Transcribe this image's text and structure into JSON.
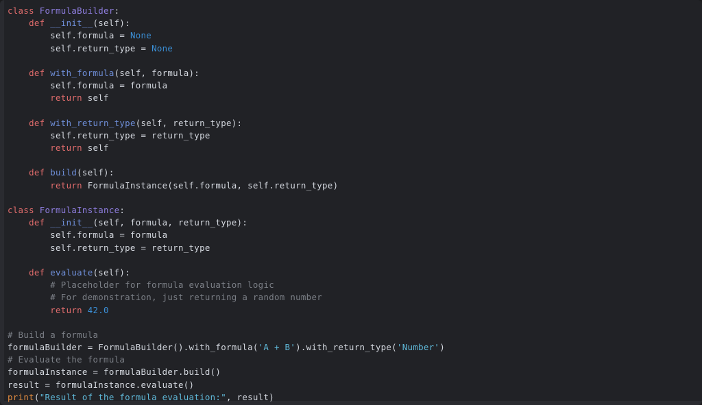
{
  "editor": {
    "language": "python",
    "background": "#212226",
    "panel_edge": "#2a2b30",
    "default_text": "#d3d7de"
  },
  "palette": {
    "keyword": "#e06c6c",
    "class_name": "#8f7ee0",
    "function_name": "#6f8fd9",
    "builtin": "#e08b40",
    "number": "#3b8fd6",
    "constant": "#3b8fd6",
    "string": "#5fb8d8",
    "comment": "#7b7f86",
    "plain": "#d3d7de"
  },
  "code": {
    "plain_text": "class FormulaBuilder:\n    def __init__(self):\n        self.formula = None\n        self.return_type = None\n\n    def with_formula(self, formula):\n        self.formula = formula\n        return self\n\n    def with_return_type(self, return_type):\n        self.return_type = return_type\n        return self\n\n    def build(self):\n        return FormulaInstance(self.formula, self.return_type)\n\nclass FormulaInstance:\n    def __init__(self, formula, return_type):\n        self.formula = formula\n        self.return_type = return_type\n\n    def evaluate(self):\n        # Placeholder for formula evaluation logic\n        # For demonstration, just returning a random number\n        return 42.0\n\n# Build a formula\nformulaBuilder = FormulaBuilder().with_formula('A + B').with_return_type('Number')\n# Evaluate the formula\nformulaInstance = formulaBuilder.build()\nresult = formulaInstance.evaluate()\nprint(\"Result of the formula evaluation:\", result)",
    "lines": [
      {
        "n": 1,
        "tokens": [
          {
            "t": "class",
            "c": "class"
          },
          {
            "t": " ",
            "c": "plain"
          },
          {
            "t": "FormulaBuilder",
            "c": "classname"
          },
          {
            "t": ":",
            "c": "punct"
          }
        ]
      },
      {
        "n": 2,
        "tokens": [
          {
            "t": "    ",
            "c": "plain"
          },
          {
            "t": "def",
            "c": "def"
          },
          {
            "t": " ",
            "c": "plain"
          },
          {
            "t": "__init__",
            "c": "funcname"
          },
          {
            "t": "(self):",
            "c": "punct"
          }
        ]
      },
      {
        "n": 3,
        "tokens": [
          {
            "t": "        self.formula = ",
            "c": "plain"
          },
          {
            "t": "None",
            "c": "const"
          }
        ]
      },
      {
        "n": 4,
        "tokens": [
          {
            "t": "        self.return_type = ",
            "c": "plain"
          },
          {
            "t": "None",
            "c": "const"
          }
        ]
      },
      {
        "n": 5,
        "tokens": []
      },
      {
        "n": 6,
        "tokens": [
          {
            "t": "    ",
            "c": "plain"
          },
          {
            "t": "def",
            "c": "def"
          },
          {
            "t": " ",
            "c": "plain"
          },
          {
            "t": "with_formula",
            "c": "funcname"
          },
          {
            "t": "(self, formula):",
            "c": "punct"
          }
        ]
      },
      {
        "n": 7,
        "tokens": [
          {
            "t": "        self.formula = formula",
            "c": "plain"
          }
        ]
      },
      {
        "n": 8,
        "tokens": [
          {
            "t": "        ",
            "c": "plain"
          },
          {
            "t": "return",
            "c": "keyword"
          },
          {
            "t": " self",
            "c": "plain"
          }
        ]
      },
      {
        "n": 9,
        "tokens": []
      },
      {
        "n": 10,
        "tokens": [
          {
            "t": "    ",
            "c": "plain"
          },
          {
            "t": "def",
            "c": "def"
          },
          {
            "t": " ",
            "c": "plain"
          },
          {
            "t": "with_return_type",
            "c": "funcname"
          },
          {
            "t": "(self, return_type):",
            "c": "punct"
          }
        ]
      },
      {
        "n": 11,
        "tokens": [
          {
            "t": "        self.return_type = return_type",
            "c": "plain"
          }
        ]
      },
      {
        "n": 12,
        "tokens": [
          {
            "t": "        ",
            "c": "plain"
          },
          {
            "t": "return",
            "c": "keyword"
          },
          {
            "t": " self",
            "c": "plain"
          }
        ]
      },
      {
        "n": 13,
        "tokens": []
      },
      {
        "n": 14,
        "tokens": [
          {
            "t": "    ",
            "c": "plain"
          },
          {
            "t": "def",
            "c": "def"
          },
          {
            "t": " ",
            "c": "plain"
          },
          {
            "t": "build",
            "c": "funcname"
          },
          {
            "t": "(self):",
            "c": "punct"
          }
        ]
      },
      {
        "n": 15,
        "tokens": [
          {
            "t": "        ",
            "c": "plain"
          },
          {
            "t": "return",
            "c": "keyword"
          },
          {
            "t": " FormulaInstance(self.formula, self.return_type)",
            "c": "plain"
          }
        ]
      },
      {
        "n": 16,
        "tokens": []
      },
      {
        "n": 17,
        "tokens": [
          {
            "t": "class",
            "c": "class"
          },
          {
            "t": " ",
            "c": "plain"
          },
          {
            "t": "FormulaInstance",
            "c": "classname"
          },
          {
            "t": ":",
            "c": "punct"
          }
        ]
      },
      {
        "n": 18,
        "tokens": [
          {
            "t": "    ",
            "c": "plain"
          },
          {
            "t": "def",
            "c": "def"
          },
          {
            "t": " ",
            "c": "plain"
          },
          {
            "t": "__init__",
            "c": "funcname"
          },
          {
            "t": "(self, formula, return_type):",
            "c": "punct"
          }
        ]
      },
      {
        "n": 19,
        "tokens": [
          {
            "t": "        self.formula = formula",
            "c": "plain"
          }
        ]
      },
      {
        "n": 20,
        "tokens": [
          {
            "t": "        self.return_type = return_type",
            "c": "plain"
          }
        ]
      },
      {
        "n": 21,
        "tokens": []
      },
      {
        "n": 22,
        "tokens": [
          {
            "t": "    ",
            "c": "plain"
          },
          {
            "t": "def",
            "c": "def"
          },
          {
            "t": " ",
            "c": "plain"
          },
          {
            "t": "evaluate",
            "c": "funcname"
          },
          {
            "t": "(self):",
            "c": "punct"
          }
        ]
      },
      {
        "n": 23,
        "tokens": [
          {
            "t": "        ",
            "c": "plain"
          },
          {
            "t": "# Placeholder for formula evaluation logic",
            "c": "comment"
          }
        ]
      },
      {
        "n": 24,
        "tokens": [
          {
            "t": "        ",
            "c": "plain"
          },
          {
            "t": "# For demonstration, just returning a random number",
            "c": "comment"
          }
        ]
      },
      {
        "n": 25,
        "tokens": [
          {
            "t": "        ",
            "c": "plain"
          },
          {
            "t": "return",
            "c": "keyword"
          },
          {
            "t": " ",
            "c": "plain"
          },
          {
            "t": "42.0",
            "c": "number"
          }
        ]
      },
      {
        "n": 26,
        "tokens": []
      },
      {
        "n": 27,
        "tokens": [
          {
            "t": "# Build a formula",
            "c": "comment"
          }
        ]
      },
      {
        "n": 28,
        "tokens": [
          {
            "t": "formulaBuilder = FormulaBuilder().with_formula(",
            "c": "plain"
          },
          {
            "t": "'A + B'",
            "c": "string"
          },
          {
            "t": ").with_return_type(",
            "c": "plain"
          },
          {
            "t": "'Number'",
            "c": "string"
          },
          {
            "t": ")",
            "c": "plain"
          }
        ]
      },
      {
        "n": 29,
        "tokens": [
          {
            "t": "# Evaluate the formula",
            "c": "comment"
          }
        ]
      },
      {
        "n": 30,
        "tokens": [
          {
            "t": "formulaInstance = formulaBuilder.build()",
            "c": "plain"
          }
        ]
      },
      {
        "n": 31,
        "tokens": [
          {
            "t": "result = formulaInstance.evaluate()",
            "c": "plain"
          }
        ]
      },
      {
        "n": 32,
        "tokens": [
          {
            "t": "print",
            "c": "builtin"
          },
          {
            "t": "(",
            "c": "plain"
          },
          {
            "t": "\"Result of the formula evaluation:\"",
            "c": "string"
          },
          {
            "t": ", result)",
            "c": "plain"
          }
        ]
      }
    ]
  }
}
